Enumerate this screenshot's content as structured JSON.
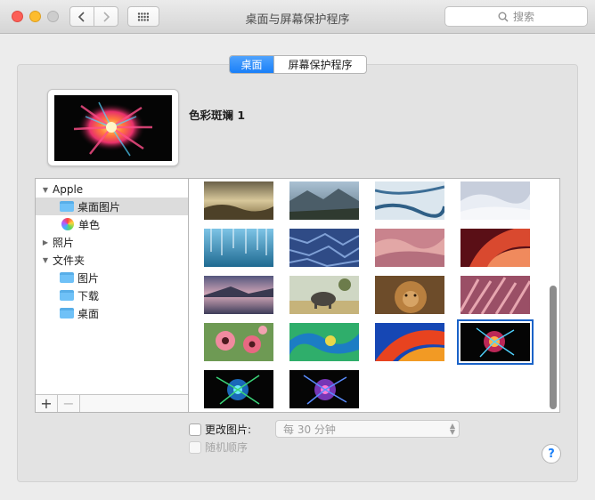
{
  "window": {
    "title": "桌面与屏幕保护程序",
    "search_placeholder": "搜索"
  },
  "tabs": [
    {
      "label": "桌面",
      "active": true
    },
    {
      "label": "屏幕保护程序",
      "active": false
    }
  ],
  "current_wallpaper": {
    "name": "色彩斑斓 1"
  },
  "sidebar": {
    "items": [
      {
        "label": "Apple",
        "expanded": true
      },
      {
        "label": "桌面图片",
        "icon": "folder-icon",
        "selected": true
      },
      {
        "label": "单色",
        "icon": "color-wheel-icon"
      },
      {
        "label": "照片",
        "expanded": false
      },
      {
        "label": "文件夹",
        "expanded": true
      },
      {
        "label": "图片",
        "icon": "folder-icon"
      },
      {
        "label": "下载",
        "icon": "folder-icon"
      },
      {
        "label": "桌面",
        "icon": "folder-icon"
      }
    ],
    "footer": {
      "add": "+",
      "remove": "−"
    }
  },
  "thumbnails": [
    {
      "name": "foggy-valley"
    },
    {
      "name": "mountain-lake"
    },
    {
      "name": "ice-cracks"
    },
    {
      "name": "snow-dunes"
    },
    {
      "name": "blue-lake-trees"
    },
    {
      "name": "blue-rock-texture"
    },
    {
      "name": "pink-sand-dunes"
    },
    {
      "name": "red-canyon"
    },
    {
      "name": "purple-lake-sunset"
    },
    {
      "name": "elephant-savanna"
    },
    {
      "name": "lion"
    },
    {
      "name": "pink-grass"
    },
    {
      "name": "poppy-flowers"
    },
    {
      "name": "green-blue-abstract"
    },
    {
      "name": "orange-blue-waves"
    },
    {
      "name": "color-burst-1",
      "selected": true
    },
    {
      "name": "color-burst-blue"
    },
    {
      "name": "color-burst-purple"
    }
  ],
  "options": {
    "change_picture_label": "更改图片:",
    "change_picture_checked": false,
    "interval_value": "每 30 分钟",
    "random_order_label": "随机顺序",
    "help_label": "?"
  }
}
